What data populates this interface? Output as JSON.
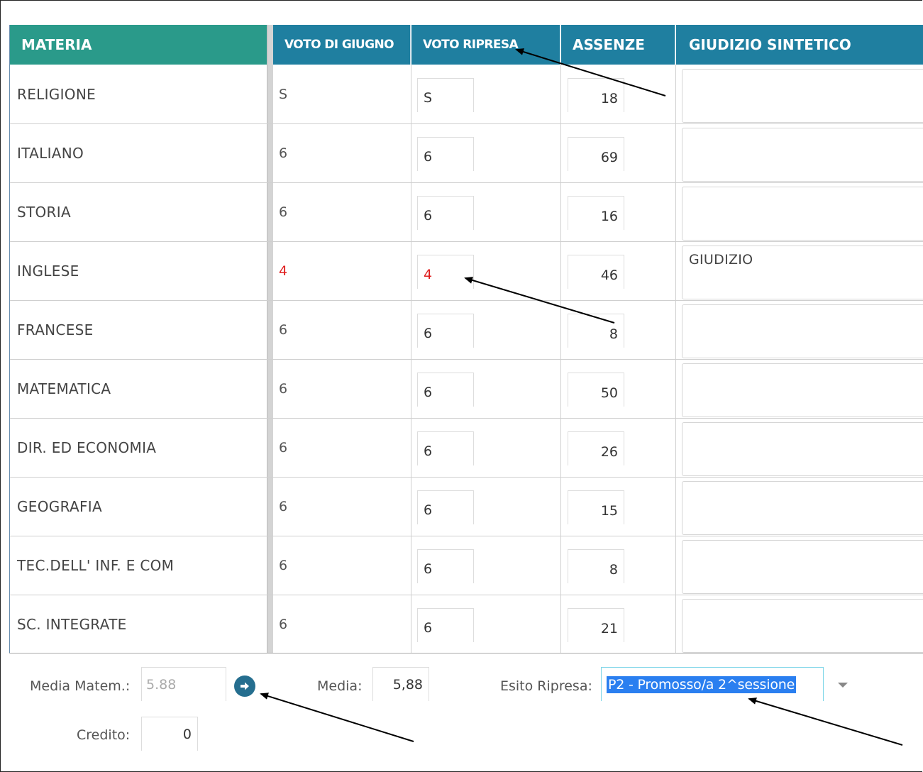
{
  "header": {
    "materia": "MATERIA",
    "voto_giugno": "VOTO DI GIUGNO",
    "voto_ripresa": "VOTO RIPRESA",
    "assenze": "ASSENZE",
    "giudizio": "GIUDIZIO SINTETICO"
  },
  "rows": [
    {
      "materia": "RELIGIONE",
      "voto_giugno": "S",
      "voto_ripresa": "S",
      "assenze": "18",
      "giudizio": ""
    },
    {
      "materia": "ITALIANO",
      "voto_giugno": "6",
      "voto_ripresa": "6",
      "assenze": "69",
      "giudizio": ""
    },
    {
      "materia": "STORIA",
      "voto_giugno": "6",
      "voto_ripresa": "6",
      "assenze": "16",
      "giudizio": ""
    },
    {
      "materia": "INGLESE",
      "voto_giugno": "4",
      "voto_ripresa": "4",
      "assenze": "46",
      "giudizio": "GIUDIZIO",
      "insufficiente": true
    },
    {
      "materia": "FRANCESE",
      "voto_giugno": "6",
      "voto_ripresa": "6",
      "assenze": "8",
      "giudizio": ""
    },
    {
      "materia": "MATEMATICA",
      "voto_giugno": "6",
      "voto_ripresa": "6",
      "assenze": "50",
      "giudizio": ""
    },
    {
      "materia": "DIR. ED ECONOMIA",
      "voto_giugno": "6",
      "voto_ripresa": "6",
      "assenze": "26",
      "giudizio": ""
    },
    {
      "materia": "GEOGRAFIA",
      "voto_giugno": "6",
      "voto_ripresa": "6",
      "assenze": "15",
      "giudizio": ""
    },
    {
      "materia": "TEC.DELL' INF. E COM",
      "voto_giugno": "6",
      "voto_ripresa": "6",
      "assenze": "8",
      "giudizio": ""
    },
    {
      "materia": "SC. INTEGRATE",
      "voto_giugno": "6",
      "voto_ripresa": "6",
      "assenze": "21",
      "giudizio": ""
    }
  ],
  "footer": {
    "media_matem_label": "Media Matem.:",
    "media_matem_value": "5.88",
    "media_label": "Media:",
    "media_value": "5,88",
    "esito_label": "Esito Ripresa:",
    "esito_value": "P2 - Promosso/a 2^sessione",
    "credito_label": "Credito:",
    "credito_value": "0"
  },
  "colors": {
    "header_materia": "#2a9a8a",
    "header_blue": "#1f7fa0",
    "insufficient": "#e02020",
    "go_button": "#256e8f",
    "selection": "#2a7ff0"
  }
}
